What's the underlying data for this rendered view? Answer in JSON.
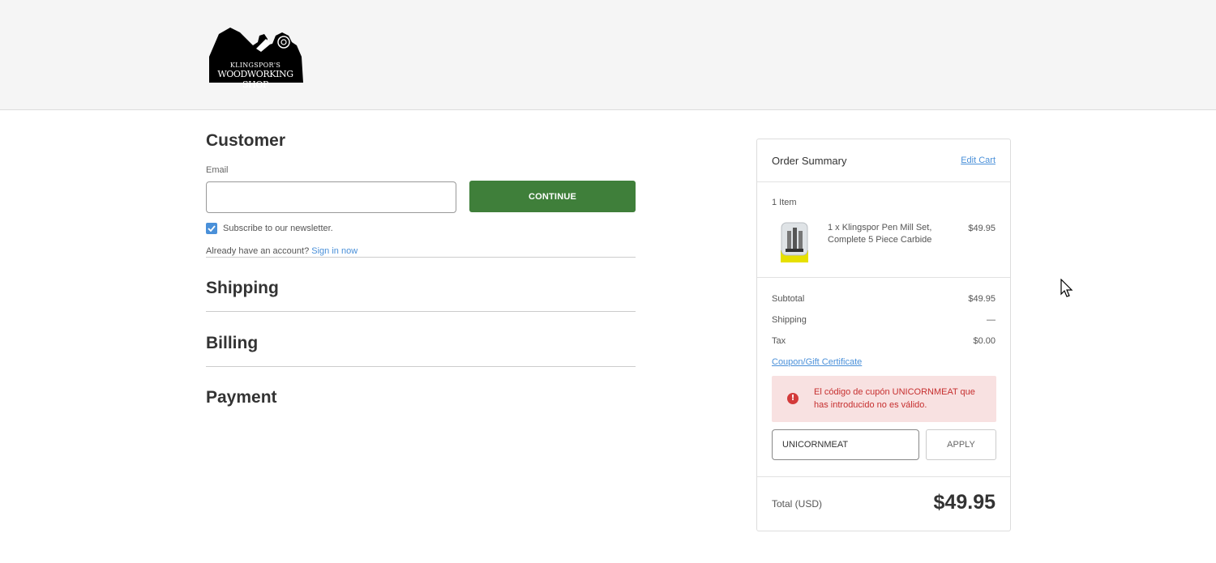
{
  "header": {
    "logo": {
      "line1": "KLINGSPOR'S",
      "line2": "WOODWORKING SHOP",
      "icon": "hand-plane-logo"
    }
  },
  "customer": {
    "title": "Customer",
    "email_label": "Email",
    "email_value": "",
    "continue_label": "CONTINUE",
    "subscribe_checked": true,
    "subscribe_label": "Subscribe to our newsletter.",
    "account_text": "Already have an account?",
    "sign_in_label": "Sign in now"
  },
  "sections": {
    "shipping": "Shipping",
    "billing": "Billing",
    "payment": "Payment"
  },
  "summary": {
    "title": "Order Summary",
    "edit_cart": "Edit Cart",
    "item_count": "1 Item",
    "item": {
      "name": "1 x Klingspor Pen Mill Set, Complete 5 Piece Carbide",
      "price": "$49.95"
    },
    "subtotal_label": "Subtotal",
    "subtotal_value": "$49.95",
    "shipping_label": "Shipping",
    "shipping_value": "—",
    "tax_label": "Tax",
    "tax_value": "$0.00",
    "coupon_link": "Coupon/Gift Certificate",
    "alert_message": "El código de cupón UNICORNMEAT que has introducido no es válido.",
    "coupon_value": "UNICORNMEAT",
    "apply_label": "APPLY",
    "total_label": "Total (USD)",
    "total_value": "$49.95"
  },
  "colors": {
    "accent": "#4a90d9",
    "continue_button": "#3f7f3a",
    "alert_bg": "#f8e1e1",
    "alert_text": "#c62f2f"
  }
}
